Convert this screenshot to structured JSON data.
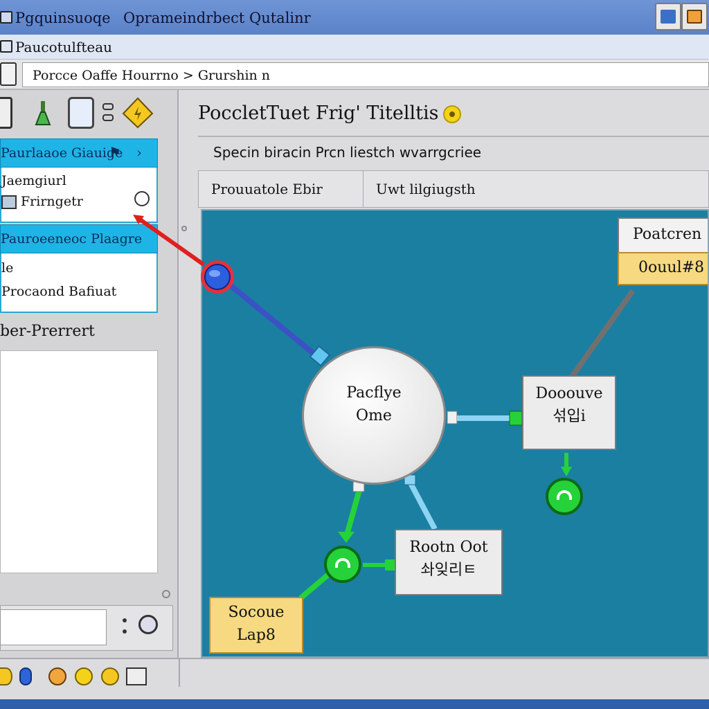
{
  "window": {
    "app_name": "Pgquinsuoqe",
    "menu_left": "Oprameindrbect",
    "menu_right": "Qutalinr"
  },
  "menubar": {
    "label": "Paucotulfteau"
  },
  "address": {
    "value": "Porcce Oaffe Hourrno > Grurshin n"
  },
  "left_panel": {
    "section1_header": "Paurlaaoe Giauige",
    "section1_line1": "Jaemgiurl",
    "section1_line2": "Frirngetr",
    "section2_header": "Pauroeeneoc Plaagre",
    "section2_line1": "le",
    "section2_line2": "Procaond Bafiuat",
    "section3_label": "ber-Prerrert"
  },
  "main": {
    "title": "PoccletTuet Frig' Titelltis",
    "subtitle": "Specin biracin Prcn liestch wvarrgcriee",
    "tab1": "Prouuatole Ebir",
    "tab2": "Uwt lilgiugsth"
  },
  "diagram": {
    "center_line1": "Pacflye",
    "center_line2": "Ome",
    "top_right_line1": "Poatcren",
    "top_right_line2": "0ouul#8",
    "mid_right_line1": "Dooouve",
    "mid_right_line2": "섞입i",
    "bottom_mid_line1": "Rootn Oot",
    "bottom_mid_line2": "솨잊리ㅌ",
    "bottom_left_line1": "Socoue",
    "bottom_left_line2": "Lap8"
  },
  "colors": {
    "titlebar": "#5a82c8",
    "panel_header": "#1fb4e6",
    "canvas": "#1b7fa2",
    "node_yellow": "#f6d981",
    "node_green": "#25d23a"
  }
}
